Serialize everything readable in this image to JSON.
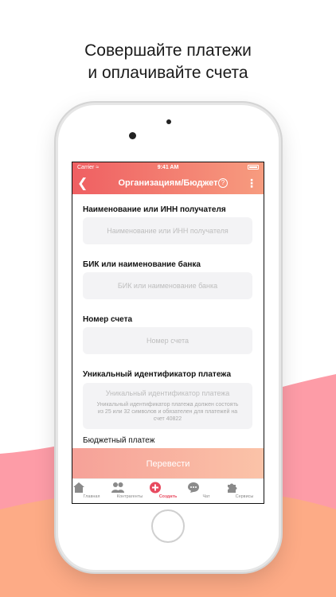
{
  "headline": {
    "line1": "Совершайте платежи",
    "line2": "и оплачивайте счета"
  },
  "status_bar": {
    "carrier": "Carrier",
    "time": "9:41 AM"
  },
  "navbar": {
    "back_icon": "chevron-left-icon",
    "title": "Организациям/Бюджет",
    "help_glyph": "?",
    "more_icon": "vertical-dots-icon"
  },
  "form": {
    "recipient": {
      "label": "Наименование или ИНН получателя",
      "placeholder": "Наименование или ИНН получателя",
      "value": ""
    },
    "bank": {
      "label": "БИК или наименование банка",
      "placeholder": "БИК или наименование банка",
      "value": ""
    },
    "account": {
      "label": "Номер счета",
      "placeholder": "Номер счета",
      "value": ""
    },
    "payment_id": {
      "label": "Уникальный идентификатор платежа",
      "placeholder": "Уникальный идентификатор платежа",
      "hint": "Уникальный идентификатор платежа должен состоять из 25 или 32 символов и обязателен для платежей на счет 40822"
    },
    "budget_payment_label": "Бюджетный платеж"
  },
  "submit_label": "Перевести",
  "tabbar": {
    "tabs": [
      {
        "label": "Главная",
        "icon": "home-icon"
      },
      {
        "label": "Контрагенты",
        "icon": "contacts-icon"
      },
      {
        "label": "Создать",
        "icon": "plus-circle-icon"
      },
      {
        "label": "Чат",
        "icon": "chat-icon"
      },
      {
        "label": "Сервисы",
        "icon": "puzzle-icon"
      }
    ],
    "active_index": 2
  },
  "colors": {
    "accent": "#e84a5f",
    "header_start": "#ef5f62",
    "header_end": "#f79c7f",
    "wave_pink": "#fd9ca7",
    "wave_orange": "#fdab86"
  }
}
